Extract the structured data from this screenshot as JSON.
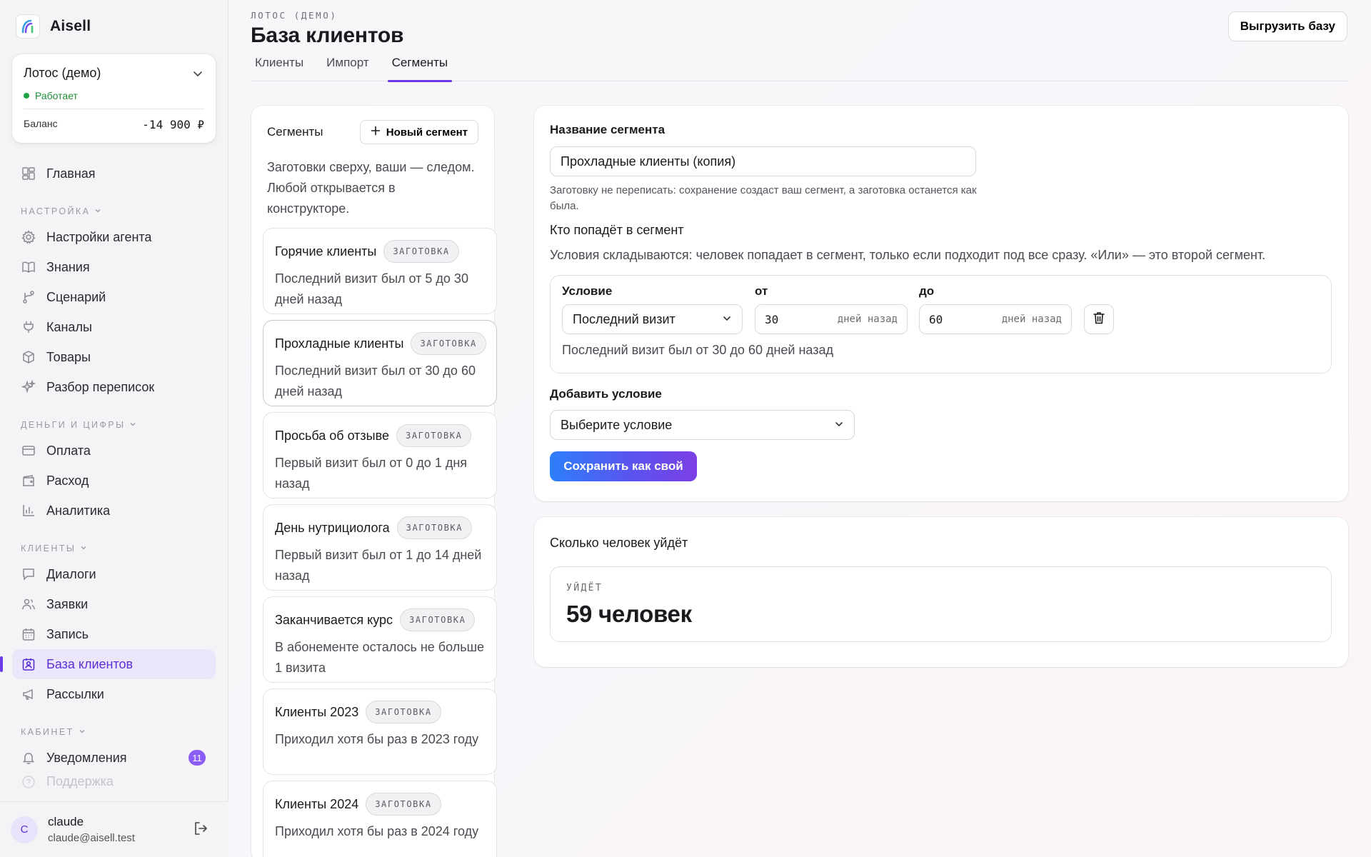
{
  "app": {
    "name": "Aisell"
  },
  "org": {
    "name": "Лотос (демо)",
    "status": "Работает",
    "balance_label": "Баланс",
    "balance_value": "-14 900 ₽"
  },
  "nav": {
    "home": "Главная",
    "section_settings": "НАСТРОЙКА",
    "agent_settings": "Настройки агента",
    "knowledge": "Знания",
    "scenario": "Сценарий",
    "channels": "Каналы",
    "products": "Товары",
    "chat_review": "Разбор переписок",
    "section_money": "ДЕНЬГИ И ЦИФРЫ",
    "payment": "Оплата",
    "expense": "Расход",
    "analytics": "Аналитика",
    "section_clients": "КЛИЕНТЫ",
    "dialogs": "Диалоги",
    "requests": "Заявки",
    "booking": "Запись",
    "client_base": "База клиентов",
    "mailings": "Рассылки",
    "section_cabinet": "КАБИНЕТ",
    "notifications": "Уведомления",
    "notifications_count": "11",
    "support": "Поддержка"
  },
  "user": {
    "initial": "C",
    "name": "claude",
    "email": "claude@aisell.test"
  },
  "header": {
    "eyebrow": "ЛОТОС (ДЕМО)",
    "title": "База клиентов",
    "export_button": "Выгрузить базу"
  },
  "tabs": [
    "Клиенты",
    "Импорт",
    "Сегменты"
  ],
  "segments": {
    "title": "Сегменты",
    "new_button": "Новый сегмент",
    "hint": "Заготовки сверху, ваши — следом. Любой открывается в конструкторе.",
    "items": [
      {
        "name": "Горячие клиенты",
        "tag": "ЗАГОТОВКА",
        "desc": "Последний визит был от 5 до 30 дней назад"
      },
      {
        "name": "Прохладные клиенты",
        "tag": "ЗАГОТОВКА",
        "desc": "Последний визит был от 30 до 60 дней назад"
      },
      {
        "name": "Просьба об отзыве",
        "tag": "ЗАГОТОВКА",
        "desc": "Первый визит был от 0 до 1 дня назад"
      },
      {
        "name": "День нутрициолога",
        "tag": "ЗАГОТОВКА",
        "desc": "Первый визит был от 1 до 14 дней назад"
      },
      {
        "name": "Заканчивается курс",
        "tag": "ЗАГОТОВКА",
        "desc": "В абонементе осталось не больше 1 визита"
      },
      {
        "name": "Клиенты 2023",
        "tag": "ЗАГОТОВКА",
        "desc": "Приходил хотя бы раз в 2023 году"
      },
      {
        "name": "Клиенты 2024",
        "tag": "ЗАГОТОВКА",
        "desc": "Приходил хотя бы раз в 2024 году"
      }
    ]
  },
  "form": {
    "name_label": "Название сегмента",
    "name_value": "Прохладные клиенты (копия)",
    "name_note": "Заготовку не переписать: сохранение создаст ваш сегмент, а заготовка останется как была.",
    "who_title": "Кто попадёт в сегмент",
    "who_desc": "Условия складываются: человек попадает в сегмент, только если подходит под все сразу. «Или» — это второй сегмент.",
    "condition": {
      "label_condition": "Условие",
      "label_from": "от",
      "label_to": "до",
      "field": "Последний визит",
      "from": "30",
      "to": "60",
      "unit": "дней назад",
      "summary": "Последний визит был от 30 до 60 дней назад"
    },
    "add_condition_label": "Добавить условие",
    "add_condition_placeholder": "Выберите условие",
    "save_button": "Сохранить как свой"
  },
  "count": {
    "title": "Сколько человек уйдёт",
    "eyebrow": "УЙДЁТ",
    "value": "59 человек"
  },
  "colors": {
    "accent": "#6b3bea",
    "status_ok": "#1fa344",
    "save_gradient_start": "#2d7ff9",
    "save_gradient_end": "#7b3fe4"
  }
}
